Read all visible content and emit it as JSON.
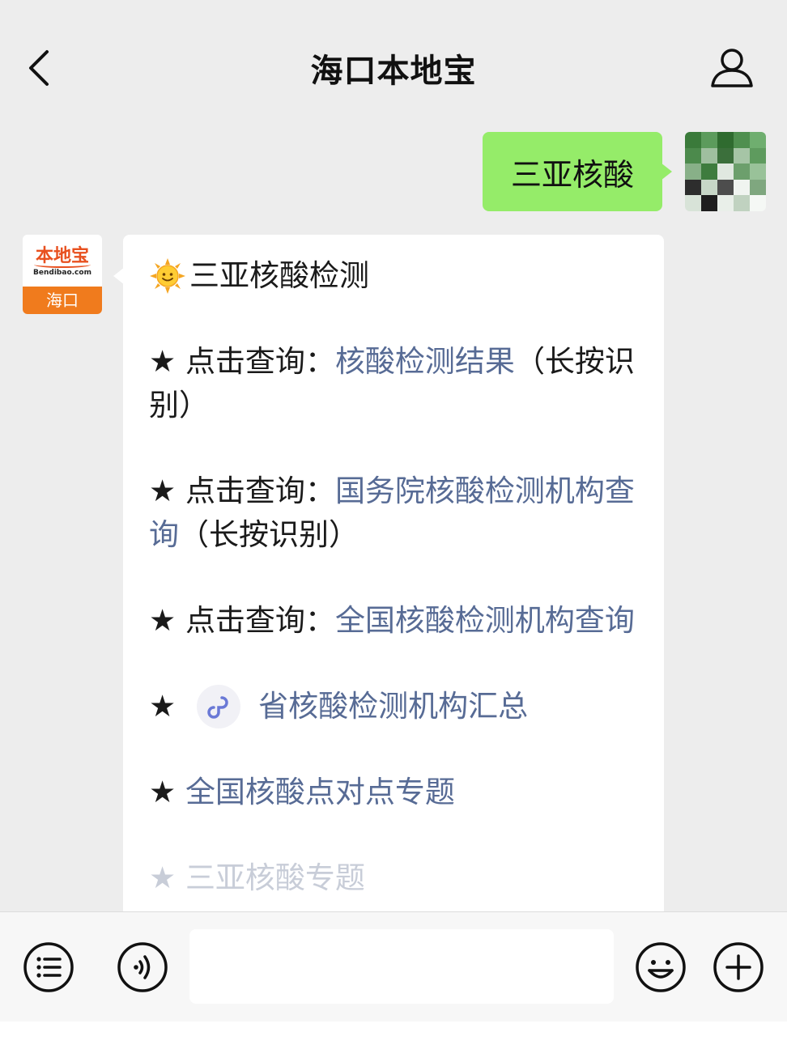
{
  "header": {
    "title": "海口本地宝"
  },
  "outgoing": {
    "text": "三亚核酸"
  },
  "bot_avatar": {
    "logo_text": "本地宝",
    "logo_sub": "Bendibao.com",
    "city": "海口"
  },
  "message": {
    "heading": "三亚核酸检测",
    "items": [
      {
        "bullet": "★ ",
        "prefix": "点击查询：",
        "link": "核酸检测结果",
        "suffix": "（长按识别）"
      },
      {
        "bullet": "★ ",
        "prefix": "点击查询：",
        "link": "国务院核酸检测机构查询",
        "suffix": "（长按识别）"
      },
      {
        "bullet": "★ ",
        "prefix": "点击查询：",
        "link": "全国核酸检测机构查询",
        "suffix": ""
      },
      {
        "bullet": "★ ",
        "link": "省核酸检测机构汇总"
      },
      {
        "bullet": "★ ",
        "link": "全国核酸点对点专题"
      },
      {
        "bullet": "★ ",
        "link": "三亚核酸专题"
      }
    ]
  },
  "input": {
    "value": ""
  },
  "colors": {
    "background": "#ededed",
    "outgoing_bubble": "#95ec69",
    "link": "#576b95",
    "brand_orange": "#f07b1d"
  },
  "icons": {
    "back": "chevron-left-icon",
    "profile": "person-icon",
    "sun": "sun-emoji-icon",
    "mini_program": "mini-program-link-icon",
    "menu": "list-menu-icon",
    "voice": "voice-icon",
    "emoji": "smiley-icon",
    "plus": "plus-icon"
  }
}
